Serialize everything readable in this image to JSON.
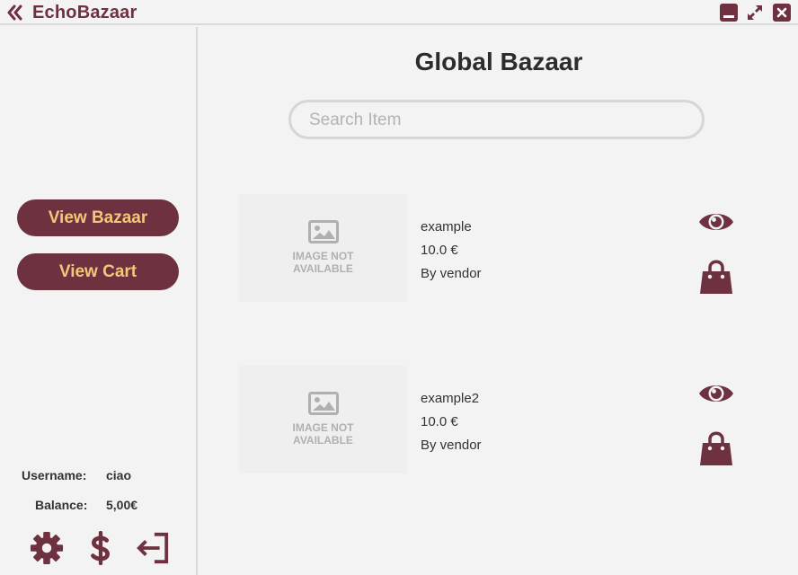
{
  "titlebar": {
    "back_icon": "double-chevron-left-icon",
    "title": "EchoBazaar",
    "minimize_icon": "minimize-icon",
    "maximize_icon": "maximize-icon",
    "close_icon": "close-icon"
  },
  "sidebar": {
    "view_bazaar_label": "View Bazaar",
    "view_cart_label": "View Cart",
    "username_label": "Username:",
    "username_value": "ciao",
    "balance_label": "Balance:",
    "balance_value": "5,00€",
    "icons": [
      "gear-icon",
      "dollar-icon",
      "logout-icon"
    ]
  },
  "main": {
    "title": "Global Bazaar",
    "search_placeholder": "Search Item",
    "items": [
      {
        "image_text_1": "IMAGE NOT",
        "image_text_2": "AVAILABLE",
        "name": "example",
        "price": "10.0 €",
        "vendor": "By vendor"
      },
      {
        "image_text_1": "IMAGE NOT",
        "image_text_2": "AVAILABLE",
        "name": "example2",
        "price": "10.0 €",
        "vendor": "By vendor"
      }
    ]
  },
  "colors": {
    "brand": "#6e3140",
    "button_text": "#f1c87a",
    "background": "#f3f3f3",
    "divider": "#d9d9d9"
  }
}
